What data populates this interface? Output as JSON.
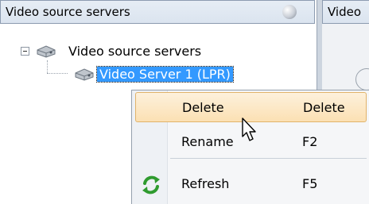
{
  "left_panel": {
    "title": "Video source servers"
  },
  "right_panel": {
    "title": "Video"
  },
  "tree": {
    "root_label": "Video source servers",
    "child_label": "Video Server 1 (LPR)"
  },
  "context_menu": {
    "items": [
      {
        "label": "Delete",
        "shortcut": "Delete"
      },
      {
        "label": "Rename",
        "shortcut": "F2"
      },
      {
        "label": "Refresh",
        "shortcut": "F5"
      }
    ]
  }
}
